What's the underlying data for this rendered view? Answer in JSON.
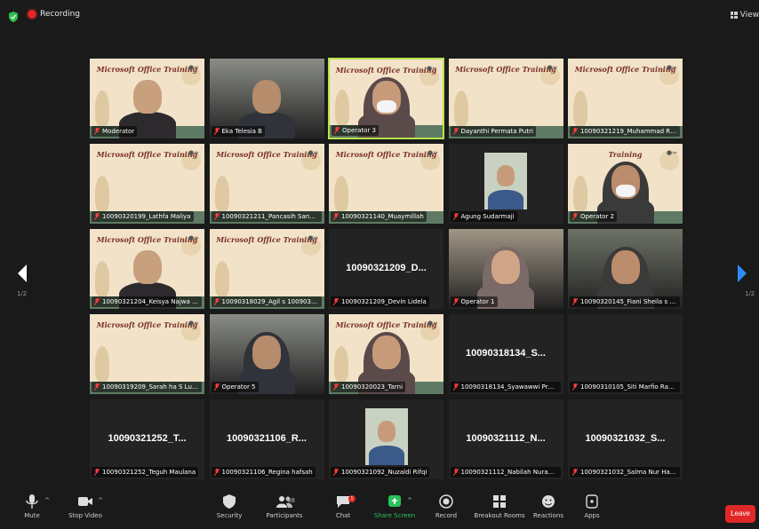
{
  "top": {
    "recording_label": "Recording",
    "view_label": "View"
  },
  "pagination": {
    "left": "1/2",
    "right": "1/2"
  },
  "tiles": [
    {
      "name": "Moderator",
      "kind": "slide_cam",
      "slide_title": "Microsoft Office Training"
    },
    {
      "name": "Eka Telesia B",
      "kind": "cam"
    },
    {
      "name": "Operator 3",
      "kind": "slide_cam",
      "slide_title": "Microsoft Office Training",
      "active": true
    },
    {
      "name": "Dayanthi Permata Putri",
      "kind": "slide",
      "slide_title": "Microsoft Office Training"
    },
    {
      "name": "10090321219_Muhammad Riz...",
      "kind": "slide",
      "slide_title": "Microsoft Office Training"
    },
    {
      "name": "10090320199_Lathfa Maliya",
      "kind": "slide",
      "slide_title": "Microsoft Office Training"
    },
    {
      "name": "10090321211_Pancasih Sandar...",
      "kind": "slide",
      "slide_title": "Microsoft Office Training"
    },
    {
      "name": "10090321140_Muaymillah",
      "kind": "slide",
      "slide_title": "Microsoft Office Training"
    },
    {
      "name": "Agung Sudarmaji",
      "kind": "thumb"
    },
    {
      "name": "Operator 2",
      "kind": "slide_cam",
      "slide_title": "Training"
    },
    {
      "name": "10090321204_Keisya Najwa Ar...",
      "kind": "slide_cam",
      "slide_title": "Microsoft Office Training"
    },
    {
      "name": "10090318029_Agil s 10090319...",
      "kind": "slide",
      "slide_title": "Microsoft Office Training"
    },
    {
      "name": "10090321209_Devin Lidela",
      "kind": "text",
      "big": "10090321209_D..."
    },
    {
      "name": "Operator 1",
      "kind": "cam"
    },
    {
      "name": "10090320145_Fiani Sheila s T...",
      "kind": "cam"
    },
    {
      "name": "10090319209_Sarah ha S Lug...",
      "kind": "slide",
      "slide_title": "Microsoft Office Training"
    },
    {
      "name": "Operator 5",
      "kind": "cam"
    },
    {
      "name": "10090320023_Tarni",
      "kind": "slide_cam",
      "slide_title": "Microsoft Office Training"
    },
    {
      "name": "10090318134_Syawawwi Prata...",
      "kind": "text",
      "big": "10090318134_S..."
    },
    {
      "name": "10090310105_Siti Marfio Rah...",
      "kind": "blank"
    },
    {
      "name": "10090321252_Teguh Maulana",
      "kind": "text",
      "big": "10090321252_T..."
    },
    {
      "name": "10090321106_Regina hafsah",
      "kind": "text",
      "big": "10090321106_R..."
    },
    {
      "name": "10090321092_Nuzaldi Rifqi",
      "kind": "thumb"
    },
    {
      "name": "10090321112_Nabilah Nurami...",
      "kind": "text",
      "big": "10090321112_N..."
    },
    {
      "name": "10090321032_Salma Nur Hali...",
      "kind": "text",
      "big": "10090321032_S..."
    }
  ],
  "toolbar": [
    {
      "id": "mute",
      "label": "Mute",
      "icon": "microphone-icon"
    },
    {
      "id": "video",
      "label": "Stop Video",
      "icon": "video-camera-icon"
    },
    {
      "id": "security",
      "label": "Security",
      "icon": "shield-icon"
    },
    {
      "id": "participants",
      "label": "Participants",
      "icon": "participants-icon",
      "count": "68"
    },
    {
      "id": "chat",
      "label": "Chat",
      "icon": "chat-icon",
      "badge": "1"
    },
    {
      "id": "share",
      "label": "Share Screen",
      "icon": "share-screen-icon"
    },
    {
      "id": "record",
      "label": "Record",
      "icon": "record-icon"
    },
    {
      "id": "rooms",
      "label": "Breakout Rooms",
      "icon": "breakout-rooms-icon"
    },
    {
      "id": "reactions",
      "label": "Reactions",
      "icon": "reactions-icon"
    },
    {
      "id": "apps",
      "label": "Apps",
      "icon": "apps-icon"
    }
  ],
  "leave_label": "Leave",
  "colors": {
    "accent_green": "#b7e34b",
    "leave_red": "#e02828",
    "share_green": "#2ac25a"
  }
}
